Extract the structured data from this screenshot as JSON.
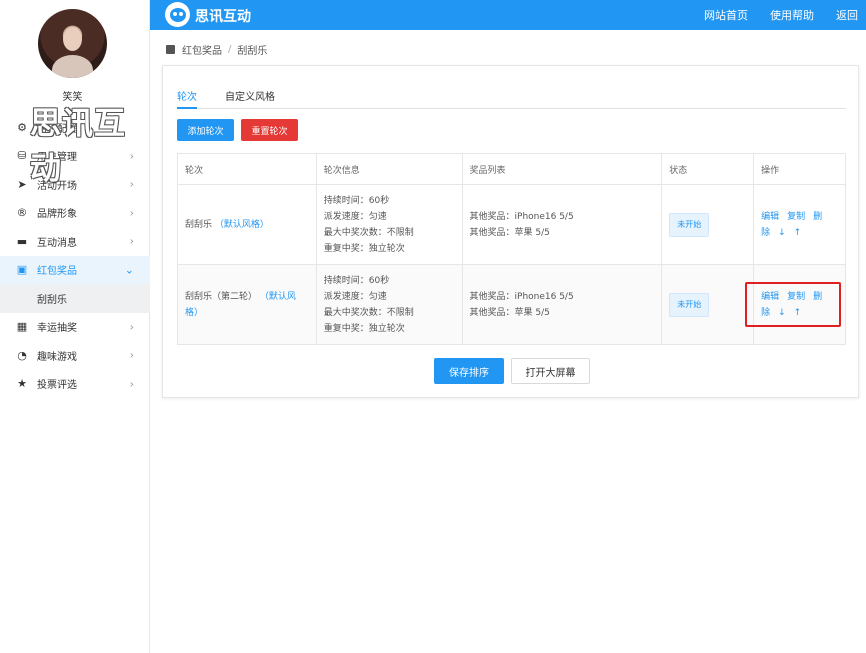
{
  "header": {
    "brand": "思讯互动",
    "nav": [
      "网站首页",
      "使用帮助",
      "返回"
    ]
  },
  "user": {
    "name": "笑笑",
    "watermark": "思讯互动"
  },
  "sidebar": {
    "items": [
      {
        "label": "活动配置",
        "icon": "gears-icon"
      },
      {
        "label": "用户管理",
        "icon": "user-bag-icon"
      },
      {
        "label": "活动开场",
        "icon": "paper-plane-icon"
      },
      {
        "label": "品牌形象",
        "icon": "registered-icon"
      },
      {
        "label": "互动消息",
        "icon": "chat-icon"
      },
      {
        "label": "红包奖品",
        "icon": "gift-box-icon"
      },
      {
        "label": "幸运抽奖",
        "icon": "grid-icon"
      },
      {
        "label": "趣味游戏",
        "icon": "pacman-icon"
      },
      {
        "label": "投票评选",
        "icon": "star-icon"
      }
    ],
    "sub_item": "刮刮乐"
  },
  "breadcrumb": {
    "parent": "红包奖品",
    "separator": "/",
    "current": "刮刮乐"
  },
  "tabs": [
    "轮次",
    "自定义风格"
  ],
  "buttons": {
    "add": "添加轮次",
    "reset": "重置轮次",
    "save": "保存排序",
    "screen": "打开大屏幕"
  },
  "table": {
    "headers": [
      "轮次",
      "轮次信息",
      "奖品列表",
      "状态",
      "操作"
    ],
    "rows": [
      {
        "name": "刮刮乐",
        "style": "（默认风格）",
        "info": [
          "持续时间：60秒",
          "派发速度：匀速",
          "最大中奖次数：不限制",
          "重复中奖：独立轮次"
        ],
        "prizes": [
          "其他奖品：iPhone16 5/5",
          "其他奖品：苹果 5/5"
        ],
        "status": "未开始",
        "ops": [
          "编辑",
          "复制",
          "删除",
          "↓",
          "↑"
        ]
      },
      {
        "name": "刮刮乐（第二轮）",
        "style": "（默认风格）",
        "info": [
          "持续时间：60秒",
          "派发速度：匀速",
          "最大中奖次数：不限制",
          "重复中奖：独立轮次"
        ],
        "prizes": [
          "其他奖品：iPhone16 5/5",
          "其他奖品：苹果 5/5"
        ],
        "status": "未开始",
        "ops": [
          "编辑",
          "复制",
          "删除",
          "↓",
          "↑"
        ]
      }
    ]
  },
  "colors": {
    "primary": "#2196f3",
    "danger": "#e53935",
    "highlight": "#e02020"
  }
}
